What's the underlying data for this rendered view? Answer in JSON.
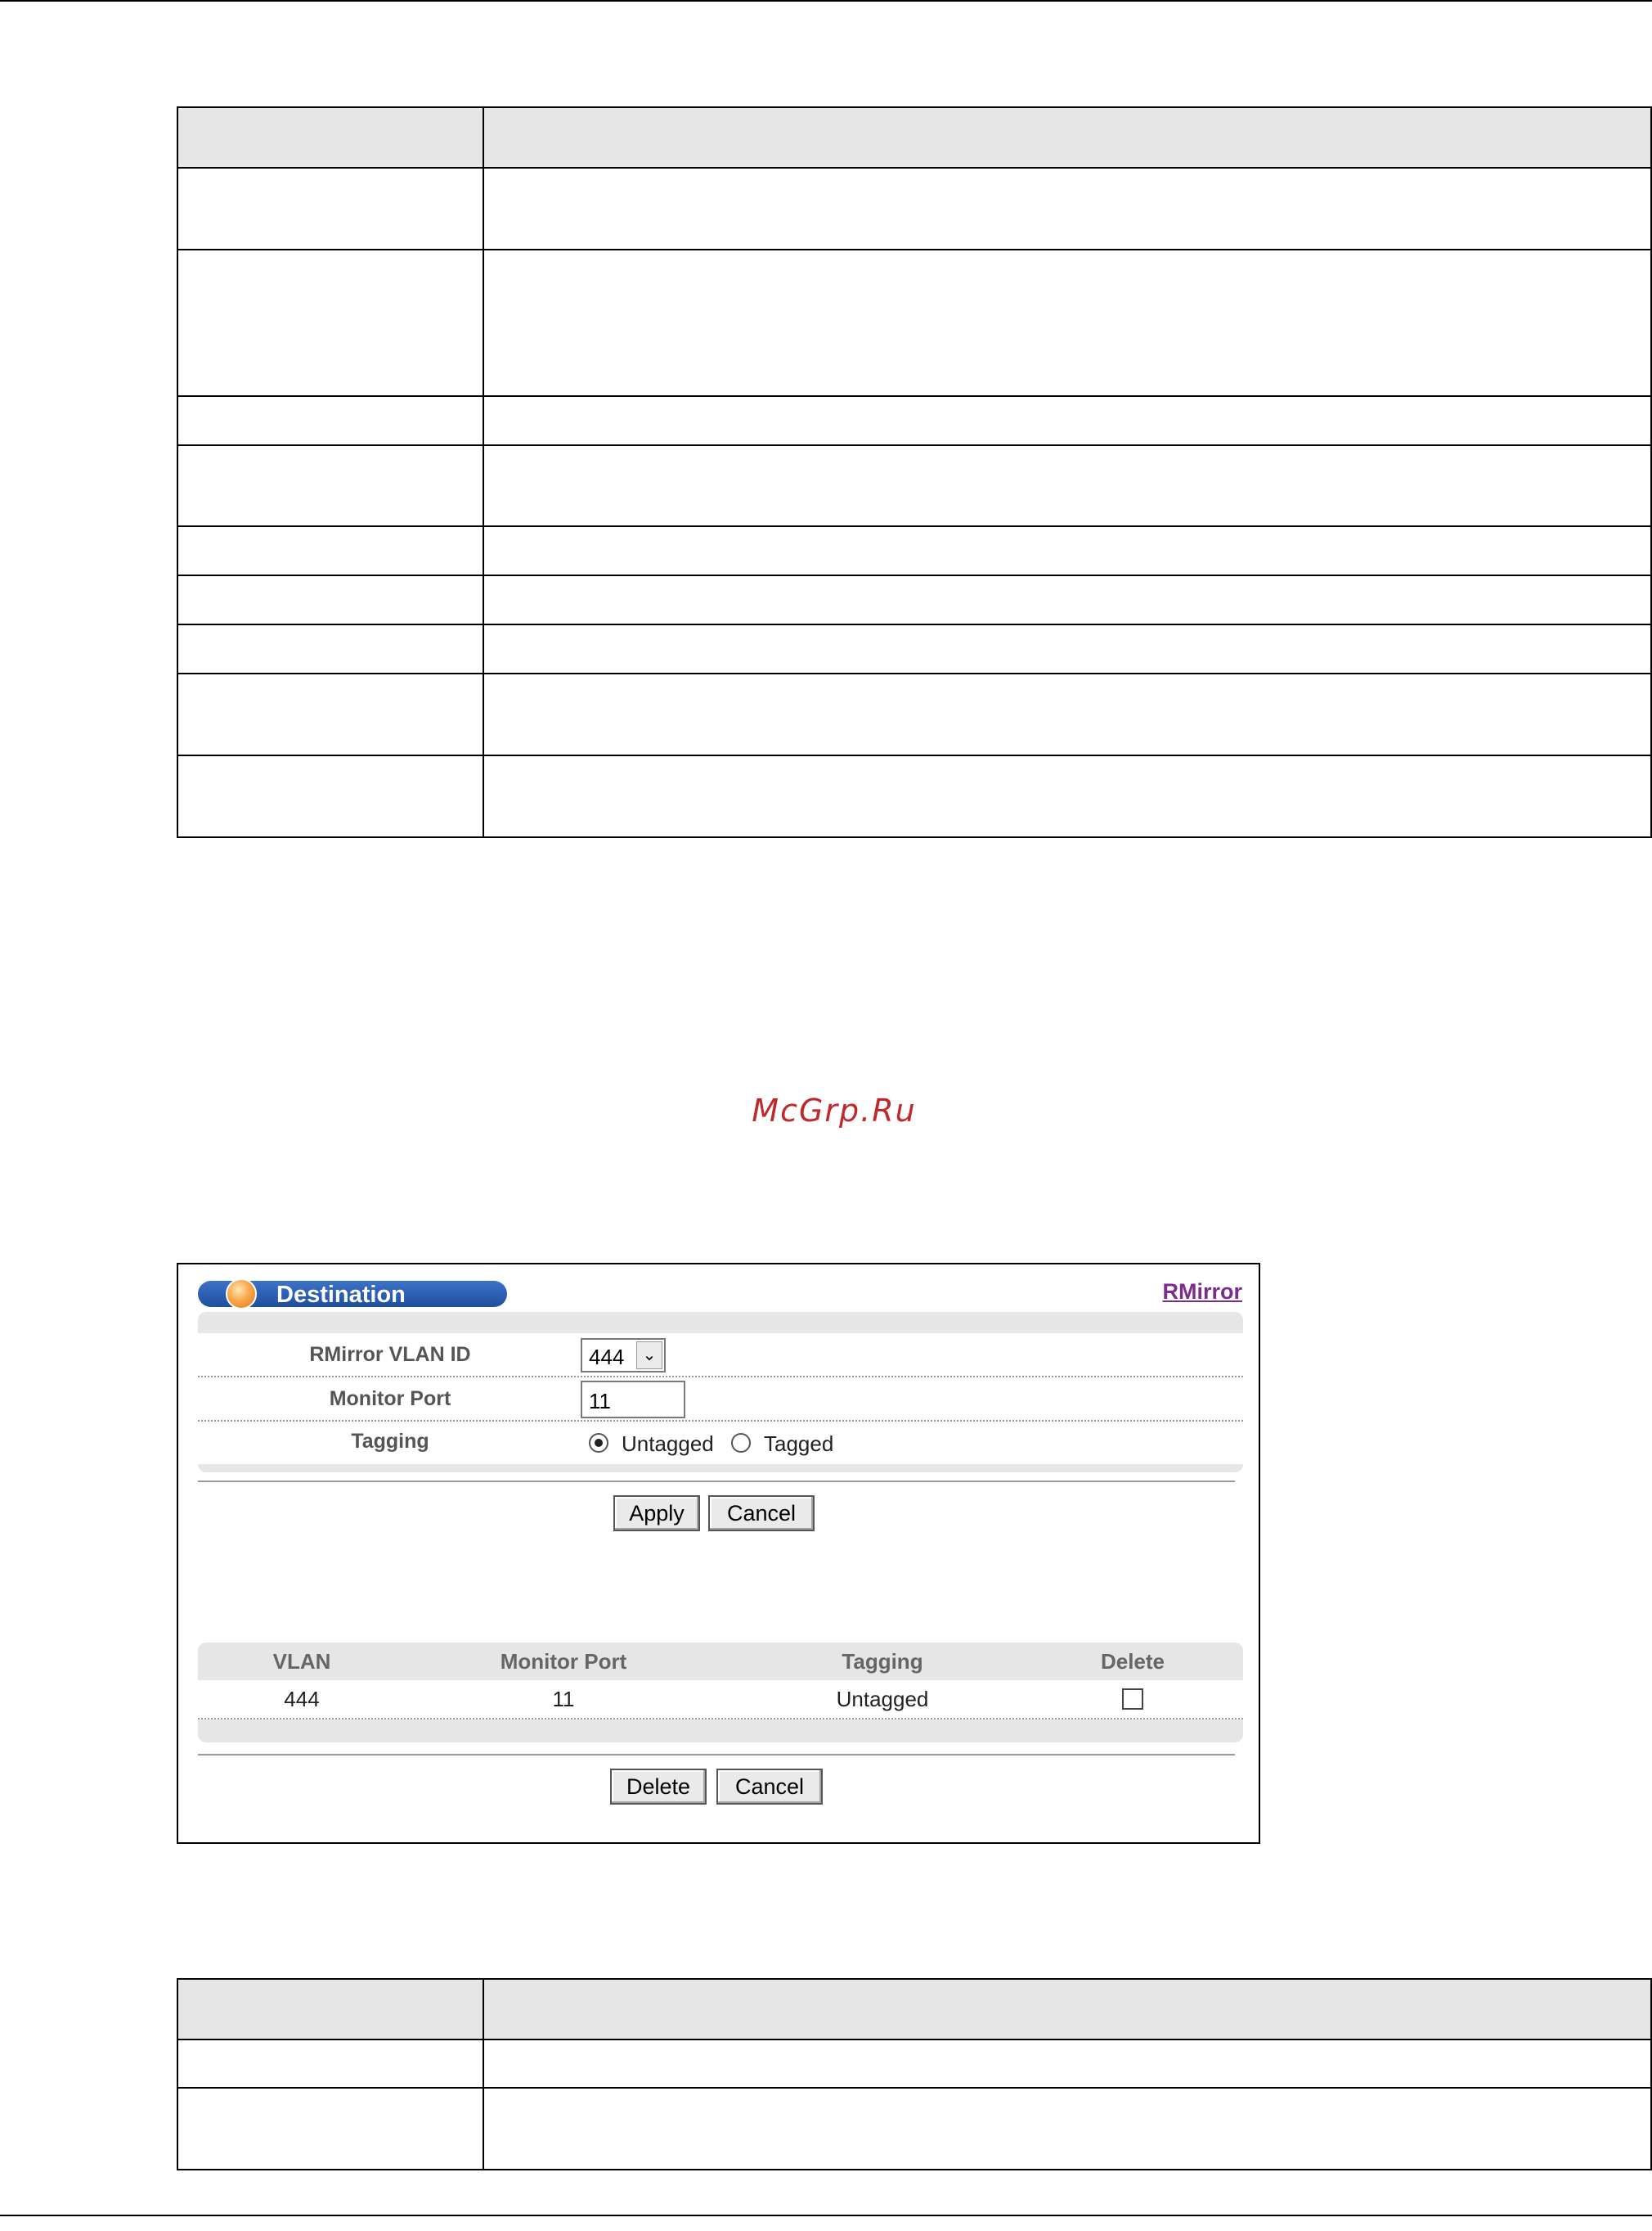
{
  "watermark": "McGrp.Ru",
  "destination": {
    "title": "Destination",
    "link_label": "RMirror",
    "fields": {
      "vlan_id_label": "RMirror VLAN ID",
      "vlan_id_value": "444",
      "monitor_port_label": "Monitor Port",
      "monitor_port_value": "11",
      "tagging_label": "Tagging",
      "tagging_options": [
        "Untagged",
        "Tagged"
      ],
      "tagging_selected": "Untagged"
    },
    "form_buttons": {
      "apply": "Apply",
      "cancel": "Cancel"
    },
    "table": {
      "headers": [
        "VLAN",
        "Monitor Port",
        "Tagging",
        "Delete"
      ],
      "rows": [
        {
          "vlan": "444",
          "monitor_port": "11",
          "tagging": "Untagged",
          "delete": false
        }
      ]
    },
    "table_buttons": {
      "delete": "Delete",
      "cancel": "Cancel"
    }
  }
}
